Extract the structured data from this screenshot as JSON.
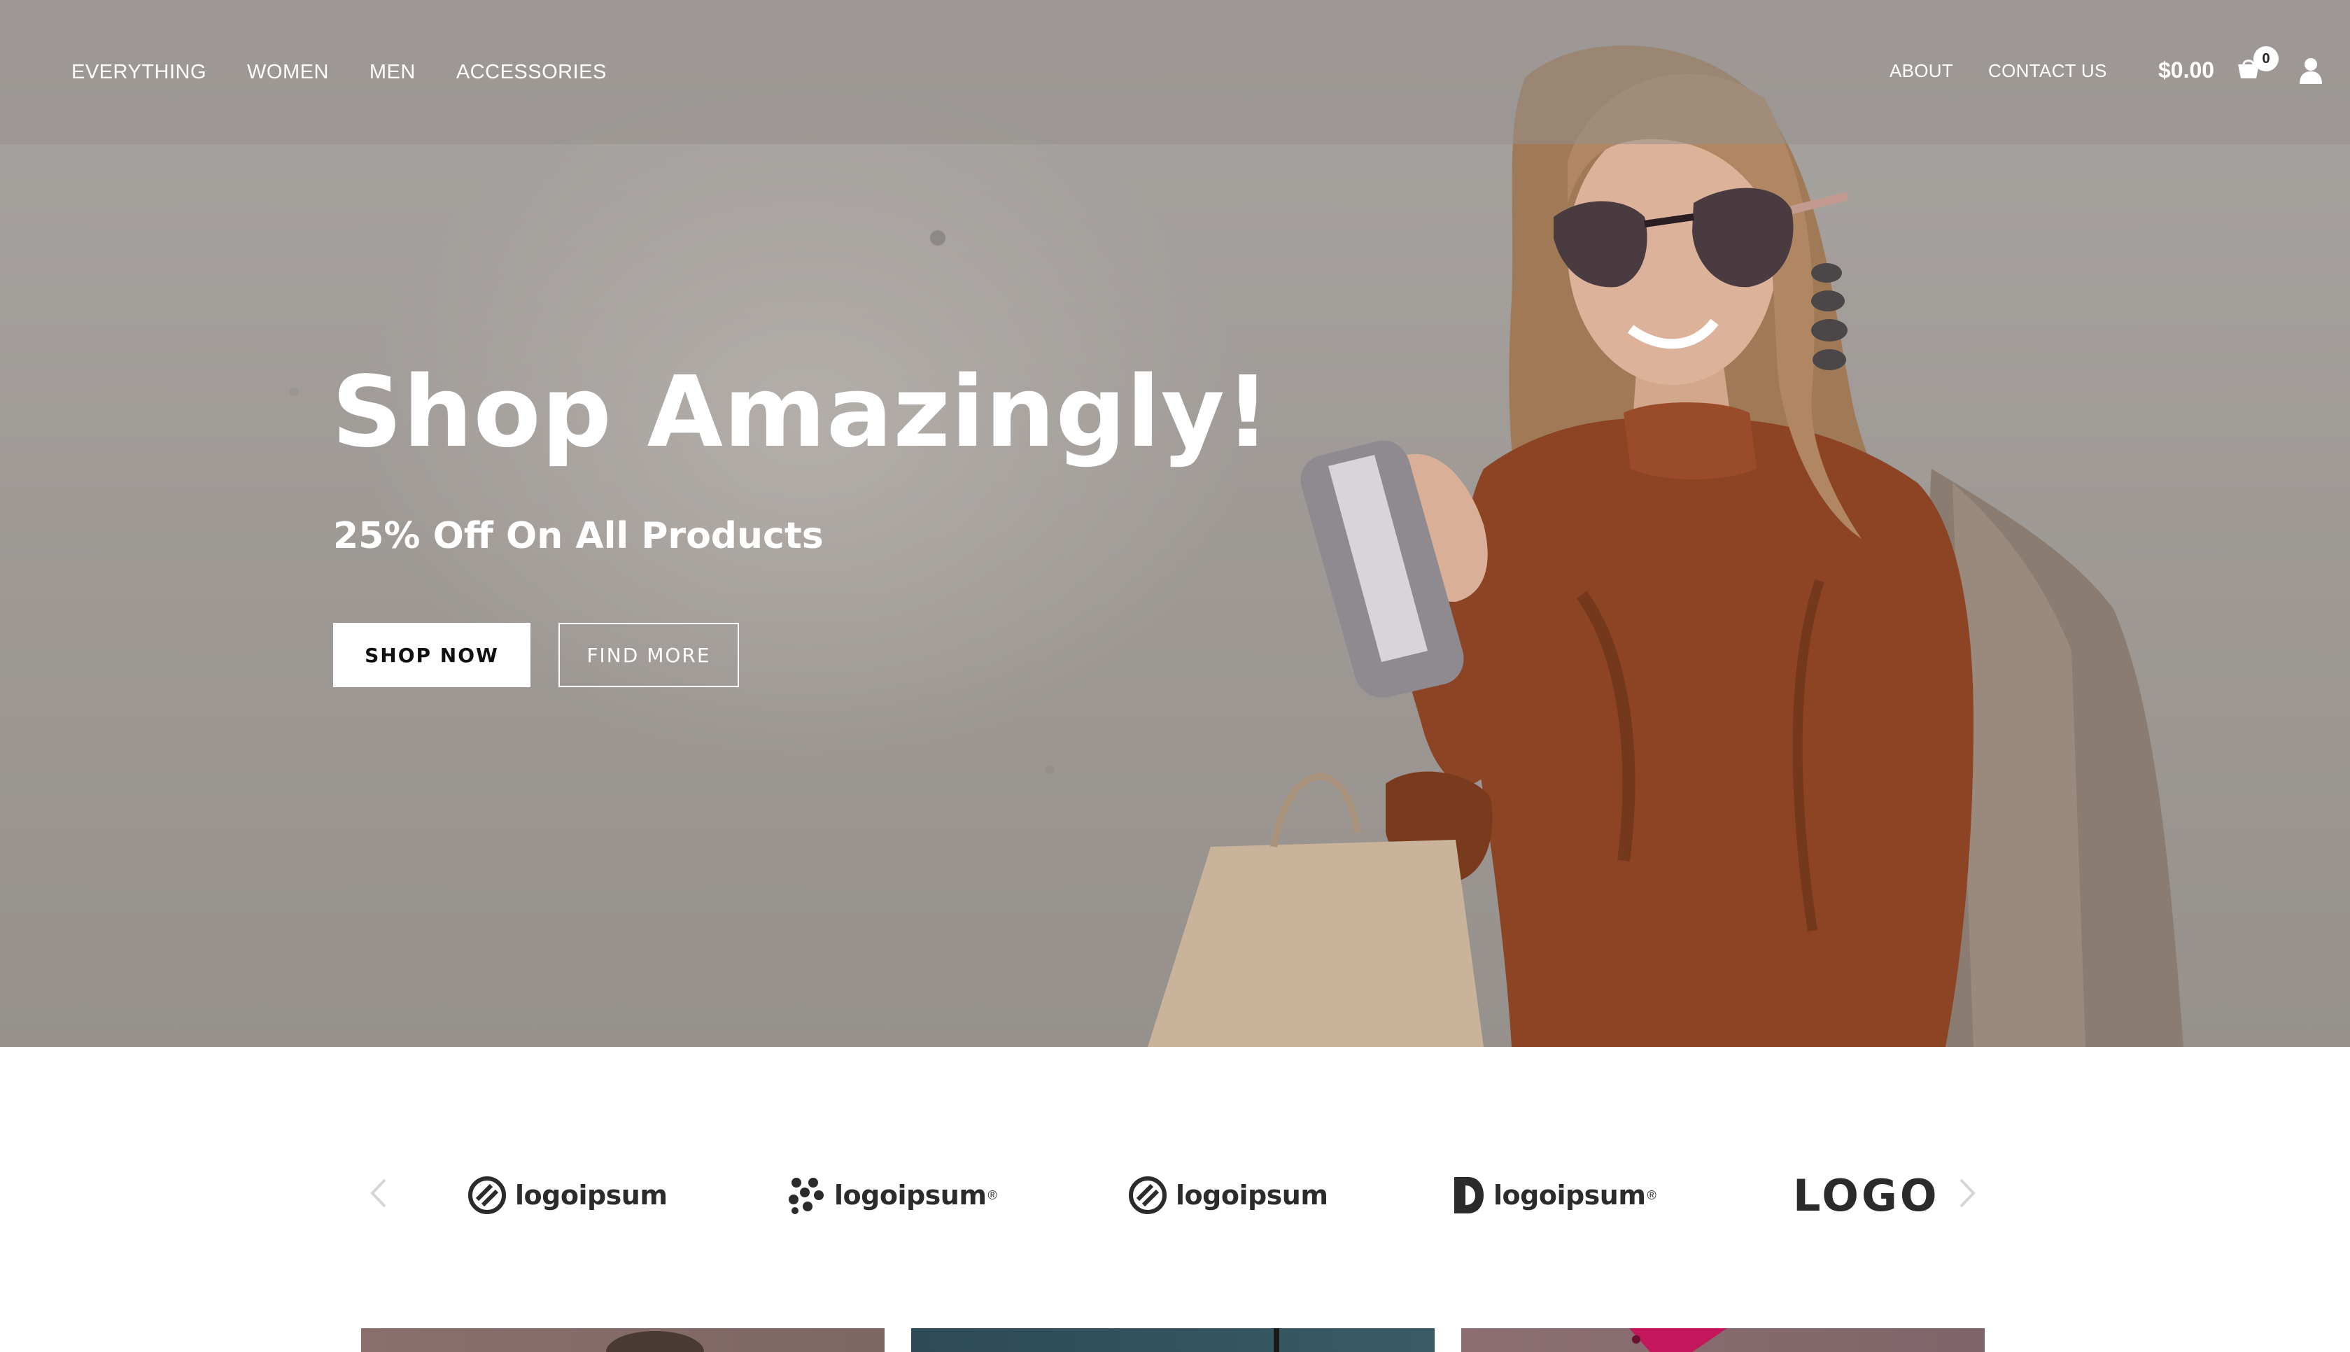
{
  "nav": {
    "left_links": [
      "EVERYTHING",
      "WOMEN",
      "MEN",
      "ACCESSORIES"
    ],
    "about": "ABOUT",
    "contact": "CONTACT US",
    "cart_total": "$0.00",
    "cart_count": "0"
  },
  "hero": {
    "title": "Shop Amazingly!",
    "subtitle": "25% Off On All Products",
    "primary_button": "SHOP NOW",
    "secondary_button": "FIND MORE"
  },
  "logos": {
    "items": [
      "logoipsum",
      "logoipsum",
      "logoipsum",
      "logoipsum",
      "LOGO"
    ],
    "trademark": "®"
  },
  "colors": {
    "hero_background": "#a29e9a",
    "white": "#ffffff",
    "logo_dark": "#2b2b2b",
    "blouse_rust": "#8c4424"
  }
}
